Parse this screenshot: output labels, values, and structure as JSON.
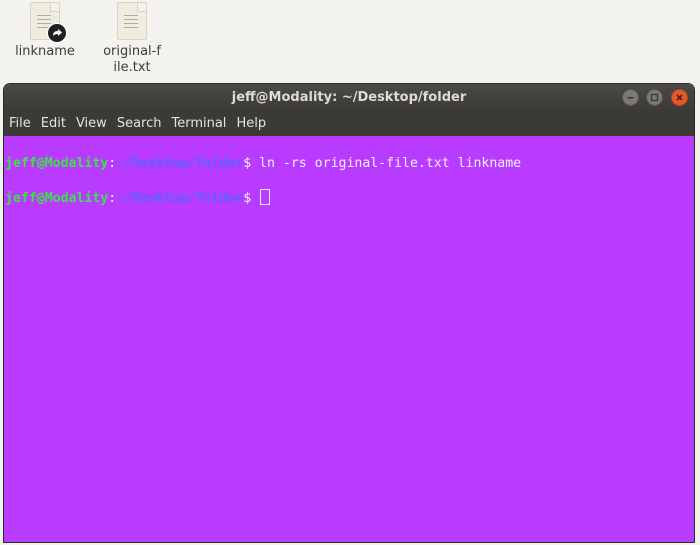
{
  "desktop": {
    "icons": [
      {
        "label": "linkname",
        "icon": "text-file-symlink-icon"
      },
      {
        "label": "original-file.txt",
        "icon": "text-file-icon"
      }
    ]
  },
  "window": {
    "title": "jeff@Modality: ~/Desktop/folder",
    "buttons": [
      "minimize-icon",
      "maximize-icon",
      "close-icon"
    ]
  },
  "menu": [
    "File",
    "Edit",
    "View",
    "Search",
    "Terminal",
    "Help"
  ],
  "terminal": {
    "background": "#b93bff",
    "lines": [
      {
        "user": "jeff@Modality",
        "sep": ":",
        "path": "~/Desktop/folder",
        "prompt": "$ ",
        "command": "ln -rs original-file.txt linkname"
      },
      {
        "user": "jeff@Modality",
        "sep": ":",
        "path": "~/Desktop/folder",
        "prompt": "$ ",
        "command": ""
      }
    ]
  }
}
